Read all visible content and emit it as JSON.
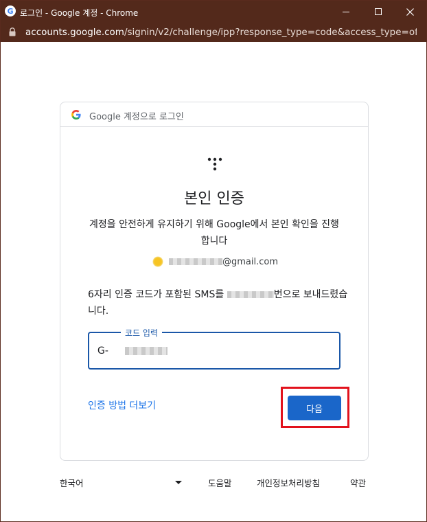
{
  "window": {
    "title": "로그인 - Google 계정 - Chrome",
    "app_icon": "G"
  },
  "address_bar": {
    "host": "accounts.google.com",
    "path": "/signin/v2/challenge/ipp?response_type=code&access_type=offlin..."
  },
  "card": {
    "header_text": "Google 계정으로 로그인",
    "heading": "본인 인증",
    "subtitle": "계정을 안전하게 유지하기 위해 Google에서 본인 확인을 진행합니다",
    "account_email_suffix": "@gmail.com",
    "sms_prefix": "6자리 인증 코드가 포함된 SMS를 ",
    "sms_suffix": "번으로 보내드렸습니다.",
    "code_field": {
      "label": "코드 입력",
      "prefix": "G-"
    },
    "more_options_link": "인증 방법 더보기",
    "next_button": "다음"
  },
  "footer": {
    "language": "한국어",
    "help": "도움말",
    "privacy": "개인정보처리방침",
    "terms": "약관"
  },
  "colors": {
    "titlebar": "#53291b",
    "primary": "#1a66c9",
    "link": "#1a73e8",
    "highlight": "#e2121c"
  }
}
